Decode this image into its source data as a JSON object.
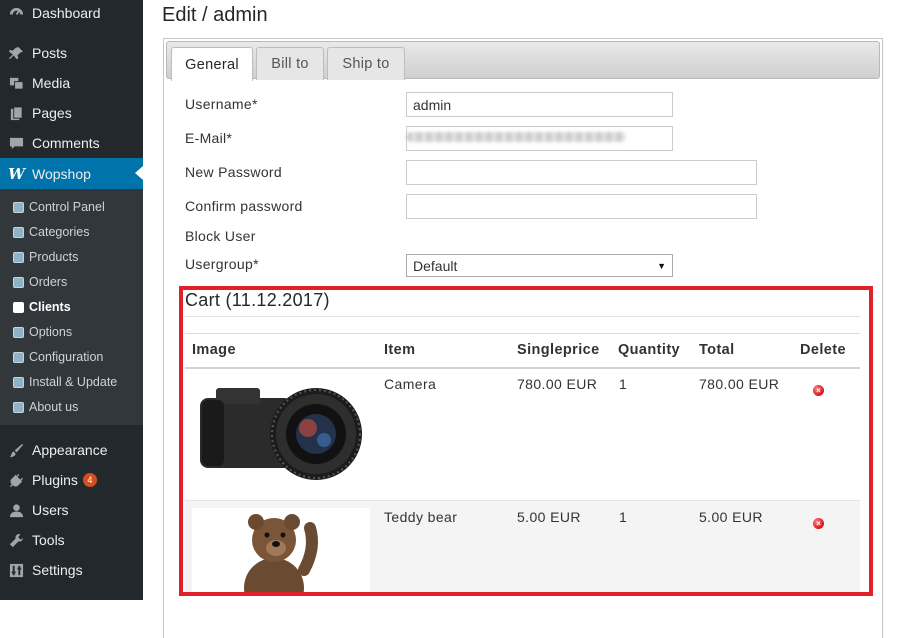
{
  "sidebar": {
    "items": [
      {
        "label": "Dashboard",
        "icon": "dashboard-icon"
      },
      {
        "label": "Posts",
        "icon": "pin-icon"
      },
      {
        "label": "Media",
        "icon": "media-icon"
      },
      {
        "label": "Pages",
        "icon": "pages-icon"
      },
      {
        "label": "Comments",
        "icon": "comment-icon"
      },
      {
        "label": "Wopshop",
        "icon": "wopshop-icon"
      },
      {
        "label": "Appearance",
        "icon": "brush-icon"
      },
      {
        "label": "Plugins",
        "icon": "plugin-icon",
        "badge": "4"
      },
      {
        "label": "Users",
        "icon": "user-icon"
      },
      {
        "label": "Tools",
        "icon": "wrench-icon"
      },
      {
        "label": "Settings",
        "icon": "settings-icon"
      }
    ],
    "submenu": [
      {
        "label": "Control Panel"
      },
      {
        "label": "Categories"
      },
      {
        "label": "Products"
      },
      {
        "label": "Orders"
      },
      {
        "label": "Clients"
      },
      {
        "label": "Options"
      },
      {
        "label": "Configuration"
      },
      {
        "label": "Install & Update"
      },
      {
        "label": "About us"
      }
    ],
    "active_item": "Wopshop",
    "current_subitem": "Clients",
    "colors": {
      "background": "#23282d",
      "active": "#0073aa",
      "submenu": "#32373c"
    }
  },
  "page": {
    "title": "Edit / admin"
  },
  "tabs": [
    {
      "label": "General",
      "active": true
    },
    {
      "label": "Bill to",
      "active": false
    },
    {
      "label": "Ship to",
      "active": false
    }
  ],
  "form": {
    "username": {
      "label": "Username*",
      "value": "admin"
    },
    "email": {
      "label": "E-Mail*",
      "value": ""
    },
    "new_password": {
      "label": "New Password",
      "value": ""
    },
    "confirm_password": {
      "label": "Confirm password",
      "value": ""
    },
    "block_user": {
      "label": "Block User"
    },
    "usergroup": {
      "label": "Usergroup*",
      "value": "Default"
    }
  },
  "cart": {
    "title": "Cart (11.12.2017)",
    "columns": [
      "Image",
      "Item",
      "Singleprice",
      "Quantity",
      "Total",
      "Delete"
    ],
    "rows": [
      {
        "item": "Camera",
        "singleprice": "780.00 EUR",
        "quantity": "1",
        "total": "780.00 EUR",
        "image": "camera-image"
      },
      {
        "item": "Teddy bear",
        "singleprice": "5.00 EUR",
        "quantity": "1",
        "total": "5.00 EUR",
        "image": "teddy-bear-image"
      }
    ],
    "highlight_color": "#e0202c"
  }
}
